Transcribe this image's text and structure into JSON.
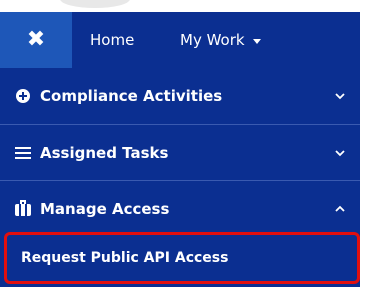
{
  "navbar": {
    "close_icon": "close-icon",
    "home_label": "Home",
    "mywork_label": "My Work",
    "mywork_caret_icon": "caret-down-icon",
    "background": "#0b2f91",
    "close_bg": "#1e57b8"
  },
  "menu": {
    "items": [
      {
        "label": "Compliance Activities",
        "icon": "plus-circle-icon",
        "chevron": "chevron-down-icon"
      },
      {
        "label": "Assigned Tasks",
        "icon": "tasks-icon",
        "chevron": "chevron-down-icon"
      },
      {
        "label": "Manage Access",
        "icon": "briefcase-icon",
        "chevron": "chevron-up-icon"
      }
    ],
    "submenu": {
      "label": "Request Public API Access",
      "highlight_color": "#e10f0f"
    }
  }
}
